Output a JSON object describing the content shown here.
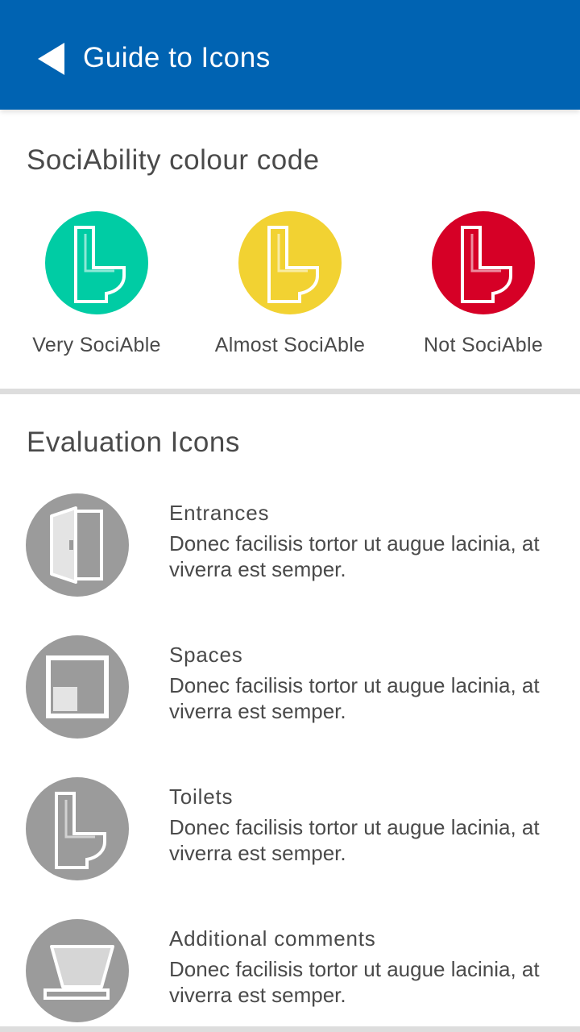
{
  "header": {
    "title": "Guide to Icons",
    "color": "#0063b2"
  },
  "colour_code": {
    "title": "SociAbility colour code",
    "items": [
      {
        "label": "Very SociAble",
        "color": "#00cca4",
        "icon": "toilet-icon"
      },
      {
        "label": "Almost SociAble",
        "color": "#f2d232",
        "icon": "toilet-icon"
      },
      {
        "label": "Not SociAble",
        "color": "#d60026",
        "icon": "toilet-icon"
      }
    ]
  },
  "evaluation": {
    "title": "Evaluation Icons",
    "items": [
      {
        "name": "Entrances",
        "description": "Donec facilisis tortor ut augue lacinia, at viverra est semper.",
        "icon": "door-icon"
      },
      {
        "name": "Spaces",
        "description": "Donec facilisis tortor ut augue lacinia, at viverra est semper.",
        "icon": "space-icon"
      },
      {
        "name": "Toilets",
        "description": "Donec facilisis tortor ut augue lacinia, at viverra est semper.",
        "icon": "toilet-icon"
      },
      {
        "name": "Additional comments",
        "description": "Donec facilisis tortor ut augue lacinia, at viverra est semper.",
        "icon": "cup-icon"
      }
    ]
  }
}
